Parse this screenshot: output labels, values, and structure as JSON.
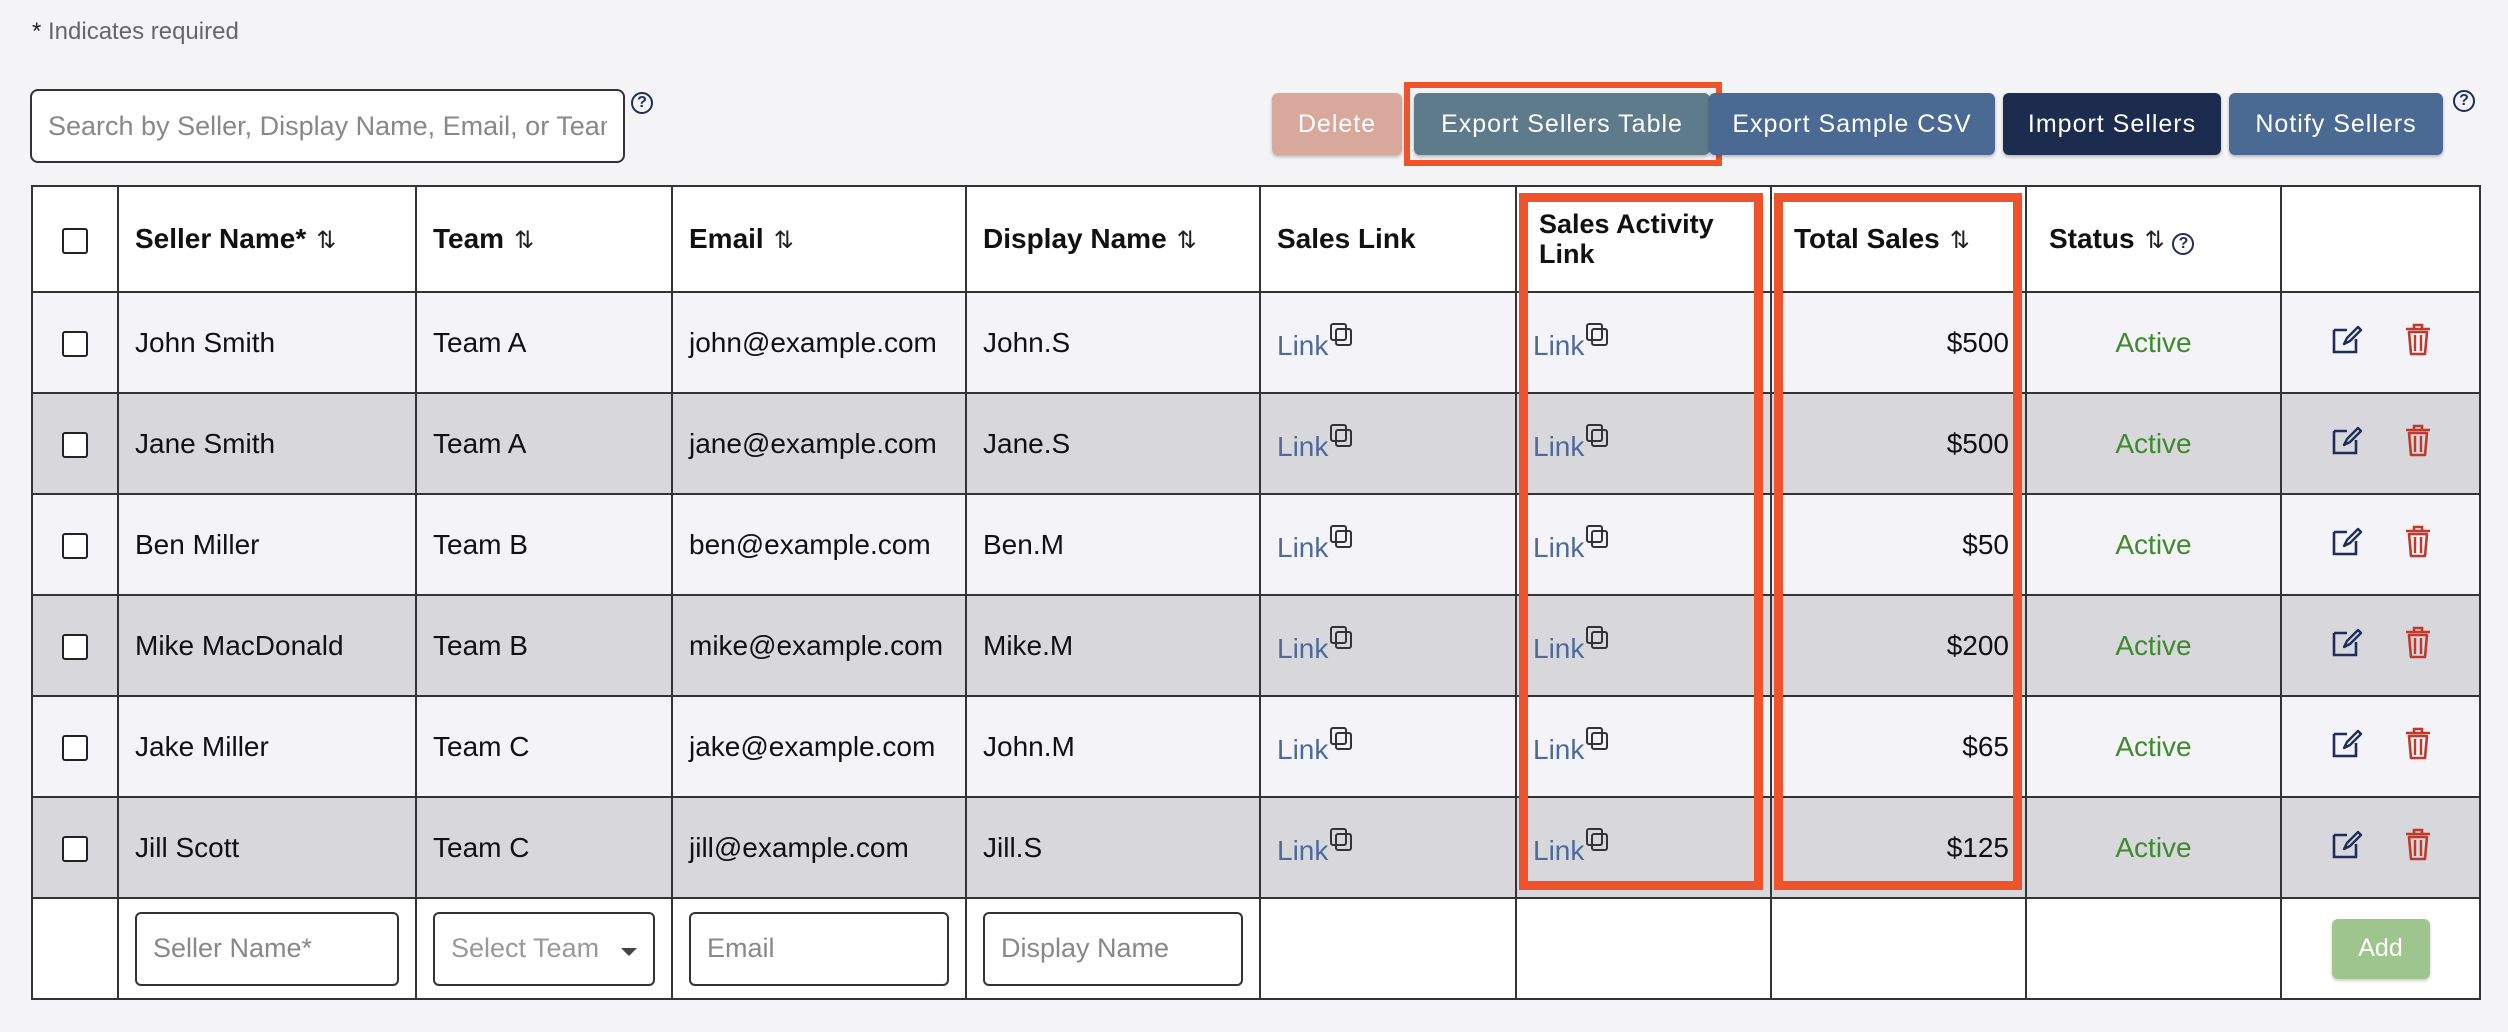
{
  "required_note": {
    "asterisk": "*",
    "text": " Indicates required"
  },
  "search": {
    "placeholder": "Search by Seller, Display Name, Email, or Team",
    "help_symbol": "?"
  },
  "toolbar": {
    "delete_label": "Delete",
    "export_table_label": "Export Sellers Table",
    "export_csv_label": "Export Sample CSV",
    "import_label": "Import Sellers",
    "notify_label": "Notify Sellers",
    "help_symbol": "?"
  },
  "table": {
    "headers": {
      "seller_name": "Seller Name*",
      "team": "Team",
      "email": "Email",
      "display_name": "Display Name",
      "sales_link": "Sales Link",
      "sales_activity_link": "Sales Activity Link",
      "total_sales": "Total Sales",
      "status": "Status",
      "sort_symbol": "⇅",
      "help_symbol": "?"
    },
    "rows": [
      {
        "seller": "John Smith",
        "team": "Team A",
        "email": "john@example.com",
        "display": "John.S",
        "sales_link": "Link",
        "activity_link": "Link",
        "total": "$500",
        "status": "Active"
      },
      {
        "seller": "Jane Smith",
        "team": "Team A",
        "email": "jane@example.com",
        "display": "Jane.S",
        "sales_link": "Link",
        "activity_link": "Link",
        "total": "$500",
        "status": "Active"
      },
      {
        "seller": "Ben Miller",
        "team": "Team B",
        "email": "ben@example.com",
        "display": "Ben.M",
        "sales_link": "Link",
        "activity_link": "Link",
        "total": "$50",
        "status": "Active"
      },
      {
        "seller": "Mike MacDonald",
        "team": "Team B",
        "email": "mike@example.com",
        "display": "Mike.M",
        "sales_link": "Link",
        "activity_link": "Link",
        "total": "$200",
        "status": "Active"
      },
      {
        "seller": "Jake Miller",
        "team": "Team C",
        "email": "jake@example.com",
        "display": "John.M",
        "sales_link": "Link",
        "activity_link": "Link",
        "total": "$65",
        "status": "Active"
      },
      {
        "seller": "Jill Scott",
        "team": "Team C",
        "email": "jill@example.com",
        "display": "Jill.S",
        "sales_link": "Link",
        "activity_link": "Link",
        "total": "$125",
        "status": "Active"
      }
    ],
    "add_row": {
      "seller_placeholder": "Seller Name*",
      "team_placeholder": "Select Team",
      "email_placeholder": "Email",
      "display_placeholder": "Display Name",
      "add_label": "Add"
    }
  },
  "colors": {
    "highlight": "#f0532a",
    "link": "#4c6a9c",
    "status_active": "#3e8a2c",
    "delete_icon": "#c0392b",
    "edit_icon": "#1f2d5a"
  },
  "icons": [
    "help-icon",
    "sort-icon",
    "copy-icon",
    "edit-icon",
    "trash-icon",
    "dropdown-caret-icon"
  ]
}
